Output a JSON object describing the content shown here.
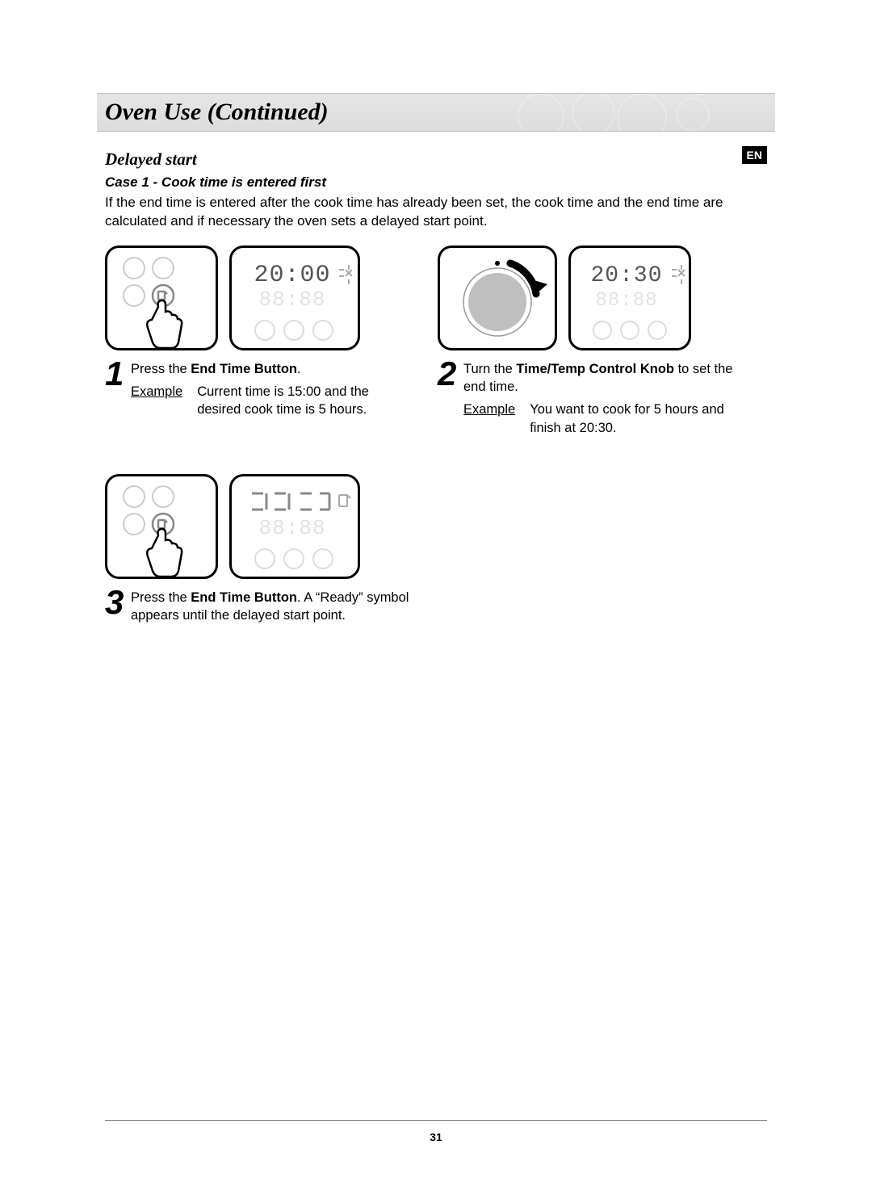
{
  "title": "Oven Use (Continued)",
  "lang_badge": "EN",
  "subheading": "Delayed start",
  "case_heading": "Case 1 - Cook time is entered first",
  "intro": "If the end time is entered after the cook time has already been set, the cook time and the end time are calculated and if necessary the oven sets a delayed start point.",
  "steps": {
    "s1": {
      "num": "1",
      "text_pre": "Press the ",
      "bold": "End Time Button",
      "text_post": ".",
      "example_label": "Example",
      "example_text": "Current time is 15:00 and the desired cook time is 5 hours.",
      "display_value": "20:00"
    },
    "s2": {
      "num": "2",
      "text_pre": "Turn the ",
      "bold": "Time/Temp Control Knob",
      "text_post": " to set the end time.",
      "example_label": "Example",
      "example_text": "You want to cook for 5 hours and finish at 20:30.",
      "display_value": "20:30"
    },
    "s3": {
      "num": "3",
      "text_pre": "Press the ",
      "bold": "End Time Button",
      "text_post": ". A “Ready” symbol appears until the delayed start point."
    }
  },
  "page_number": "31"
}
